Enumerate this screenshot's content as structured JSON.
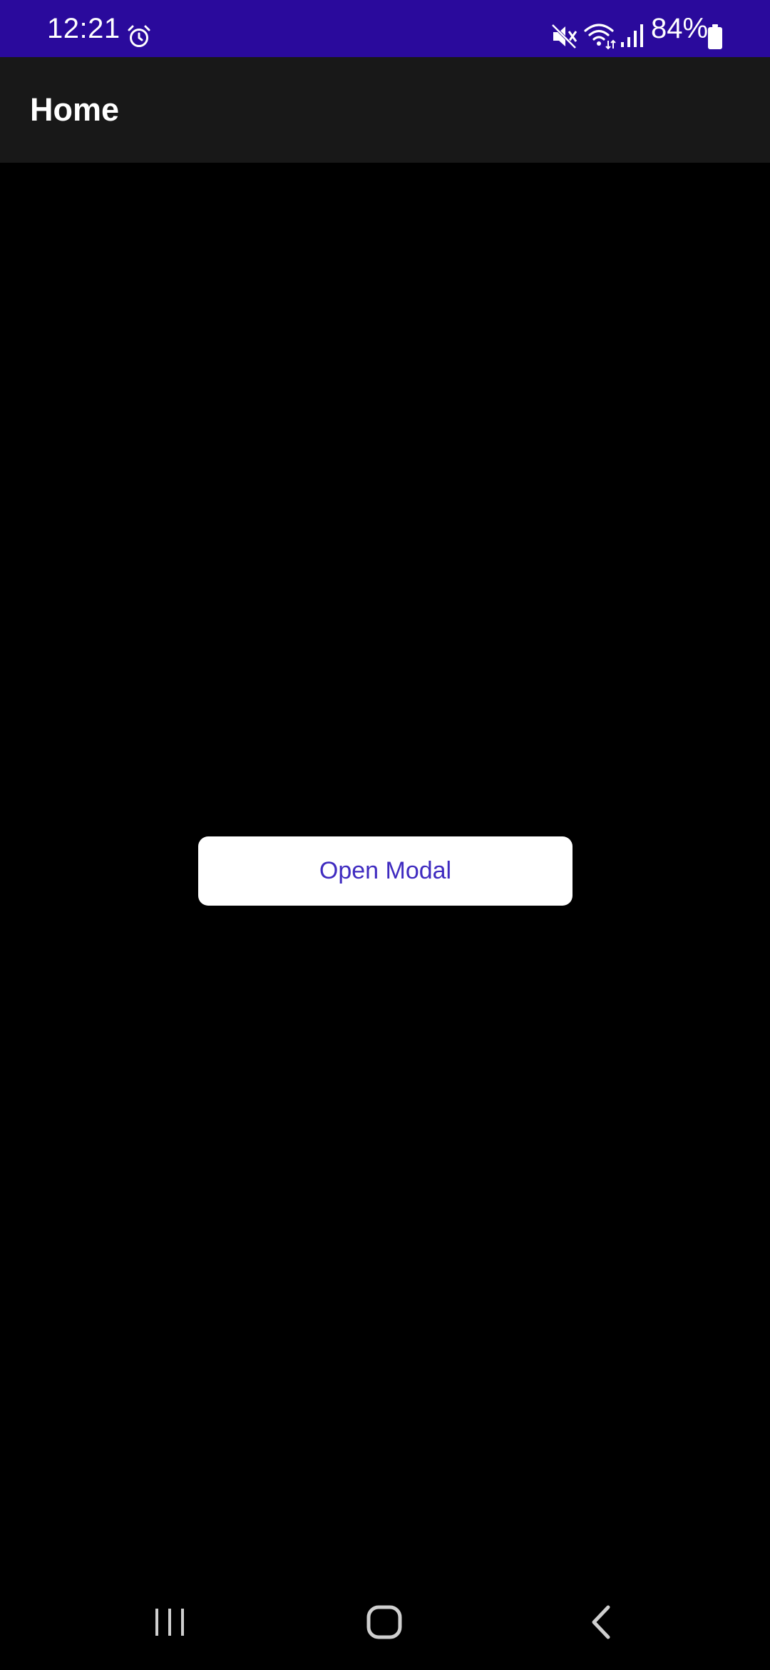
{
  "status_bar": {
    "time": "12:21",
    "battery": "84%",
    "background_color": "#2a0a9c",
    "icons": [
      "alarm-icon",
      "mute-icon",
      "wifi-icon",
      "signal-icon",
      "battery-icon"
    ]
  },
  "app_bar": {
    "title": "Home"
  },
  "main": {
    "open_modal_label": "Open Modal",
    "button_text_color": "#3f2bc0"
  },
  "nav_bar": {
    "icons": [
      "recents-icon",
      "home-icon",
      "back-icon"
    ]
  }
}
